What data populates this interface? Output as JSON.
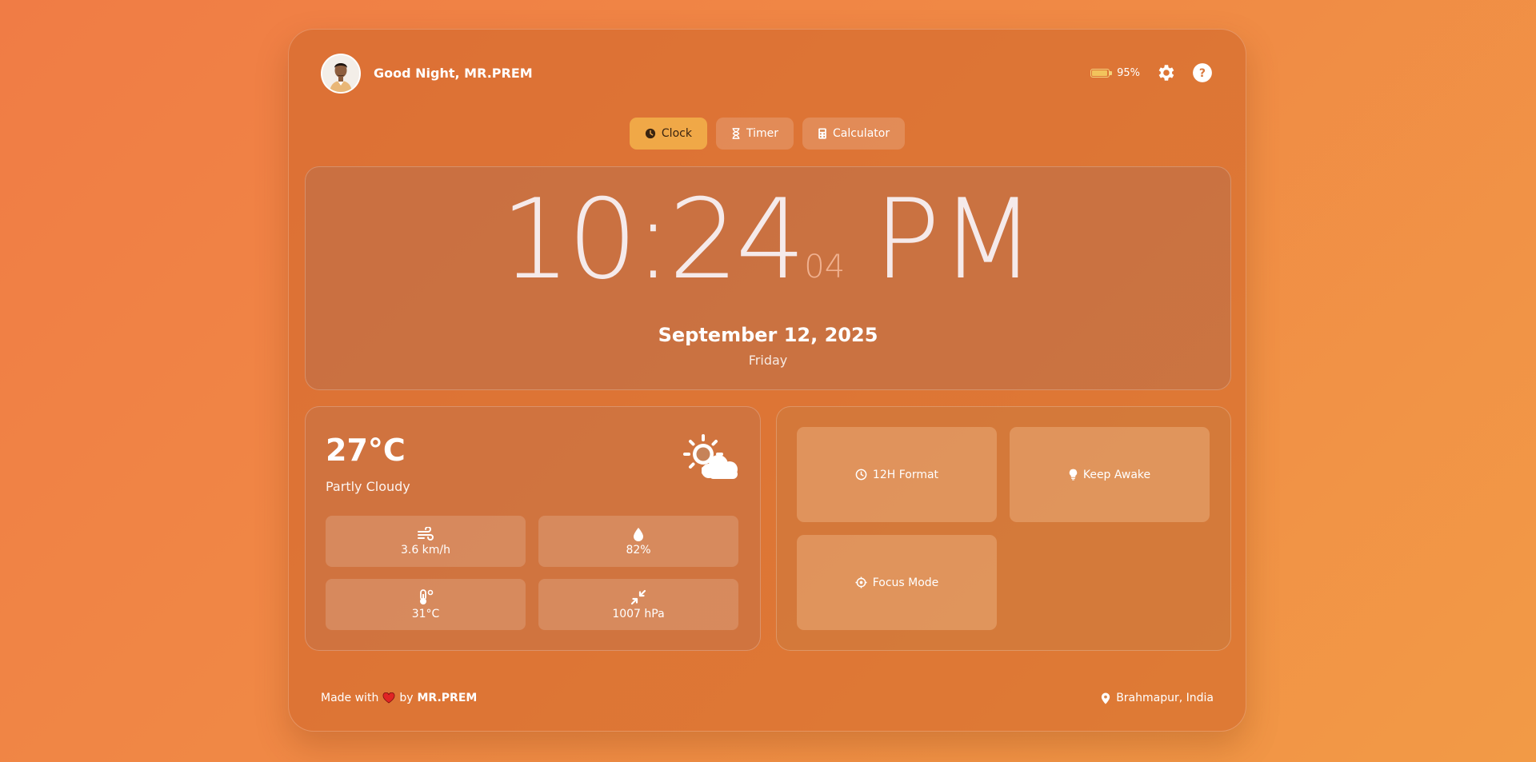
{
  "header": {
    "greeting": "Good Night, MR.PREM",
    "battery_percent": "95%",
    "battery_level": 0.95
  },
  "tabs": [
    {
      "label": "Clock",
      "icon": "clock-icon",
      "active": true
    },
    {
      "label": "Timer",
      "icon": "hourglass-icon",
      "active": false
    },
    {
      "label": "Calculator",
      "icon": "calculator-icon",
      "active": false
    }
  ],
  "clock": {
    "time": "10:24",
    "seconds": "04",
    "ampm": "PM",
    "date": "September 12, 2025",
    "day": "Friday"
  },
  "weather": {
    "temperature": "27°C",
    "condition": "Partly Cloudy",
    "icon": "partly-cloudy-icon",
    "wind": "3.6 km/h",
    "humidity": "82%",
    "feels_like": "31°C",
    "pressure": "1007 hPa"
  },
  "controls": {
    "format_label": "12H Format",
    "keep_awake_label": "Keep Awake",
    "focus_label": "Focus Mode"
  },
  "footer": {
    "made_with": "Made with",
    "by": "by",
    "author": "MR.PREM",
    "location": "Brahmapur, India"
  },
  "colors": {
    "background": "#f08a45",
    "active_tab": "#f0a847",
    "heart": "#e02424",
    "battery": "#f2c35c"
  }
}
